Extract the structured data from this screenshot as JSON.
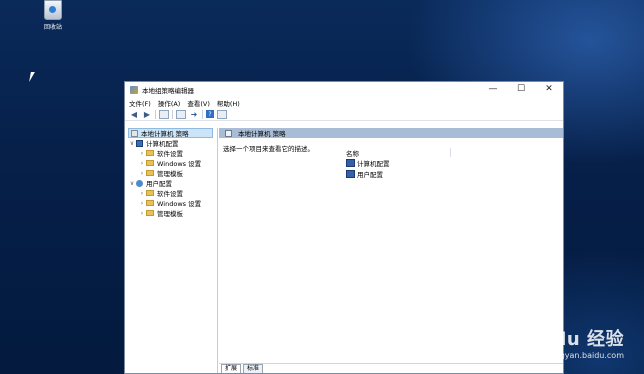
{
  "desktop": {
    "recycle_bin_label": "回收站"
  },
  "window": {
    "title": "本地组策略编辑器",
    "controls": {
      "minimize": "—",
      "maximize": "☐",
      "close": "✕"
    },
    "menu": [
      "文件(F)",
      "操作(A)",
      "查看(V)",
      "帮助(H)"
    ],
    "tree": {
      "root": "本地计算机 策略",
      "computer": "计算机配置",
      "computer_children": [
        "软件设置",
        "Windows 设置",
        "管理模板"
      ],
      "user": "用户配置",
      "user_children": [
        "软件设置",
        "Windows 设置",
        "管理模板"
      ]
    },
    "detail": {
      "header": "本地计算机 策略",
      "hint": "选择一个项目来查看它的描述。",
      "column_name": "名称",
      "items": [
        "计算机配置",
        "用户配置"
      ]
    },
    "tabs": [
      "扩展",
      "标准"
    ]
  },
  "watermark": {
    "brand": "Bai du 经验",
    "url": "jingyan.baidu.com"
  }
}
